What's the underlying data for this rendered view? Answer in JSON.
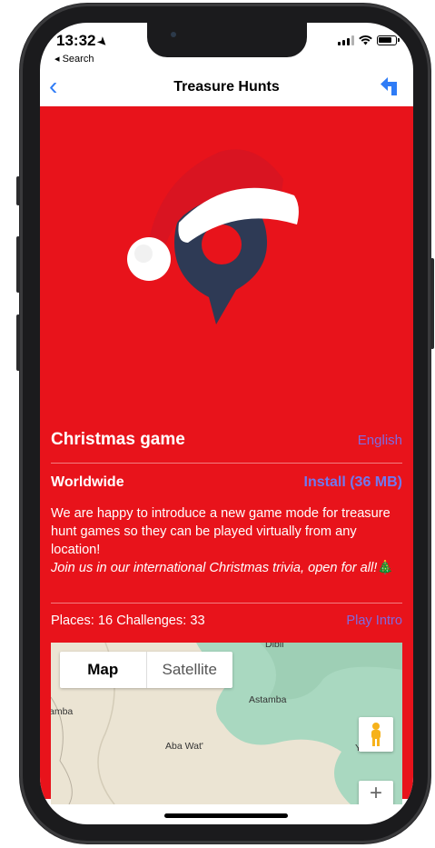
{
  "status": {
    "time": "13:32",
    "back_app": "◂ Search"
  },
  "nav": {
    "back_glyph": "‹",
    "title": "Treasure Hunts"
  },
  "game": {
    "title": "Christmas game",
    "language": "English",
    "region": "Worldwide",
    "install_label": "Install (36 MB)",
    "description": "We are happy to introduce a new game mode for treasure hunt games so they can be played virtually from any location!",
    "description_italic": "Join us in our international Christmas trivia, open for all!",
    "emoji": "🎄",
    "stats": "Places: 16  Challenges: 33",
    "intro_label": "Play Intro"
  },
  "map": {
    "tab_map": "Map",
    "tab_satellite": "Satellite",
    "labels": [
      "Dibil",
      "Astamba",
      "amba",
      "Aba Wat'",
      "Y"
    ],
    "zoom_in": "+"
  },
  "colors": {
    "background": "#e8131b",
    "link": "#7e6be0",
    "nav_accent": "#2f7cf6",
    "logo_navy": "#2e3a55"
  }
}
